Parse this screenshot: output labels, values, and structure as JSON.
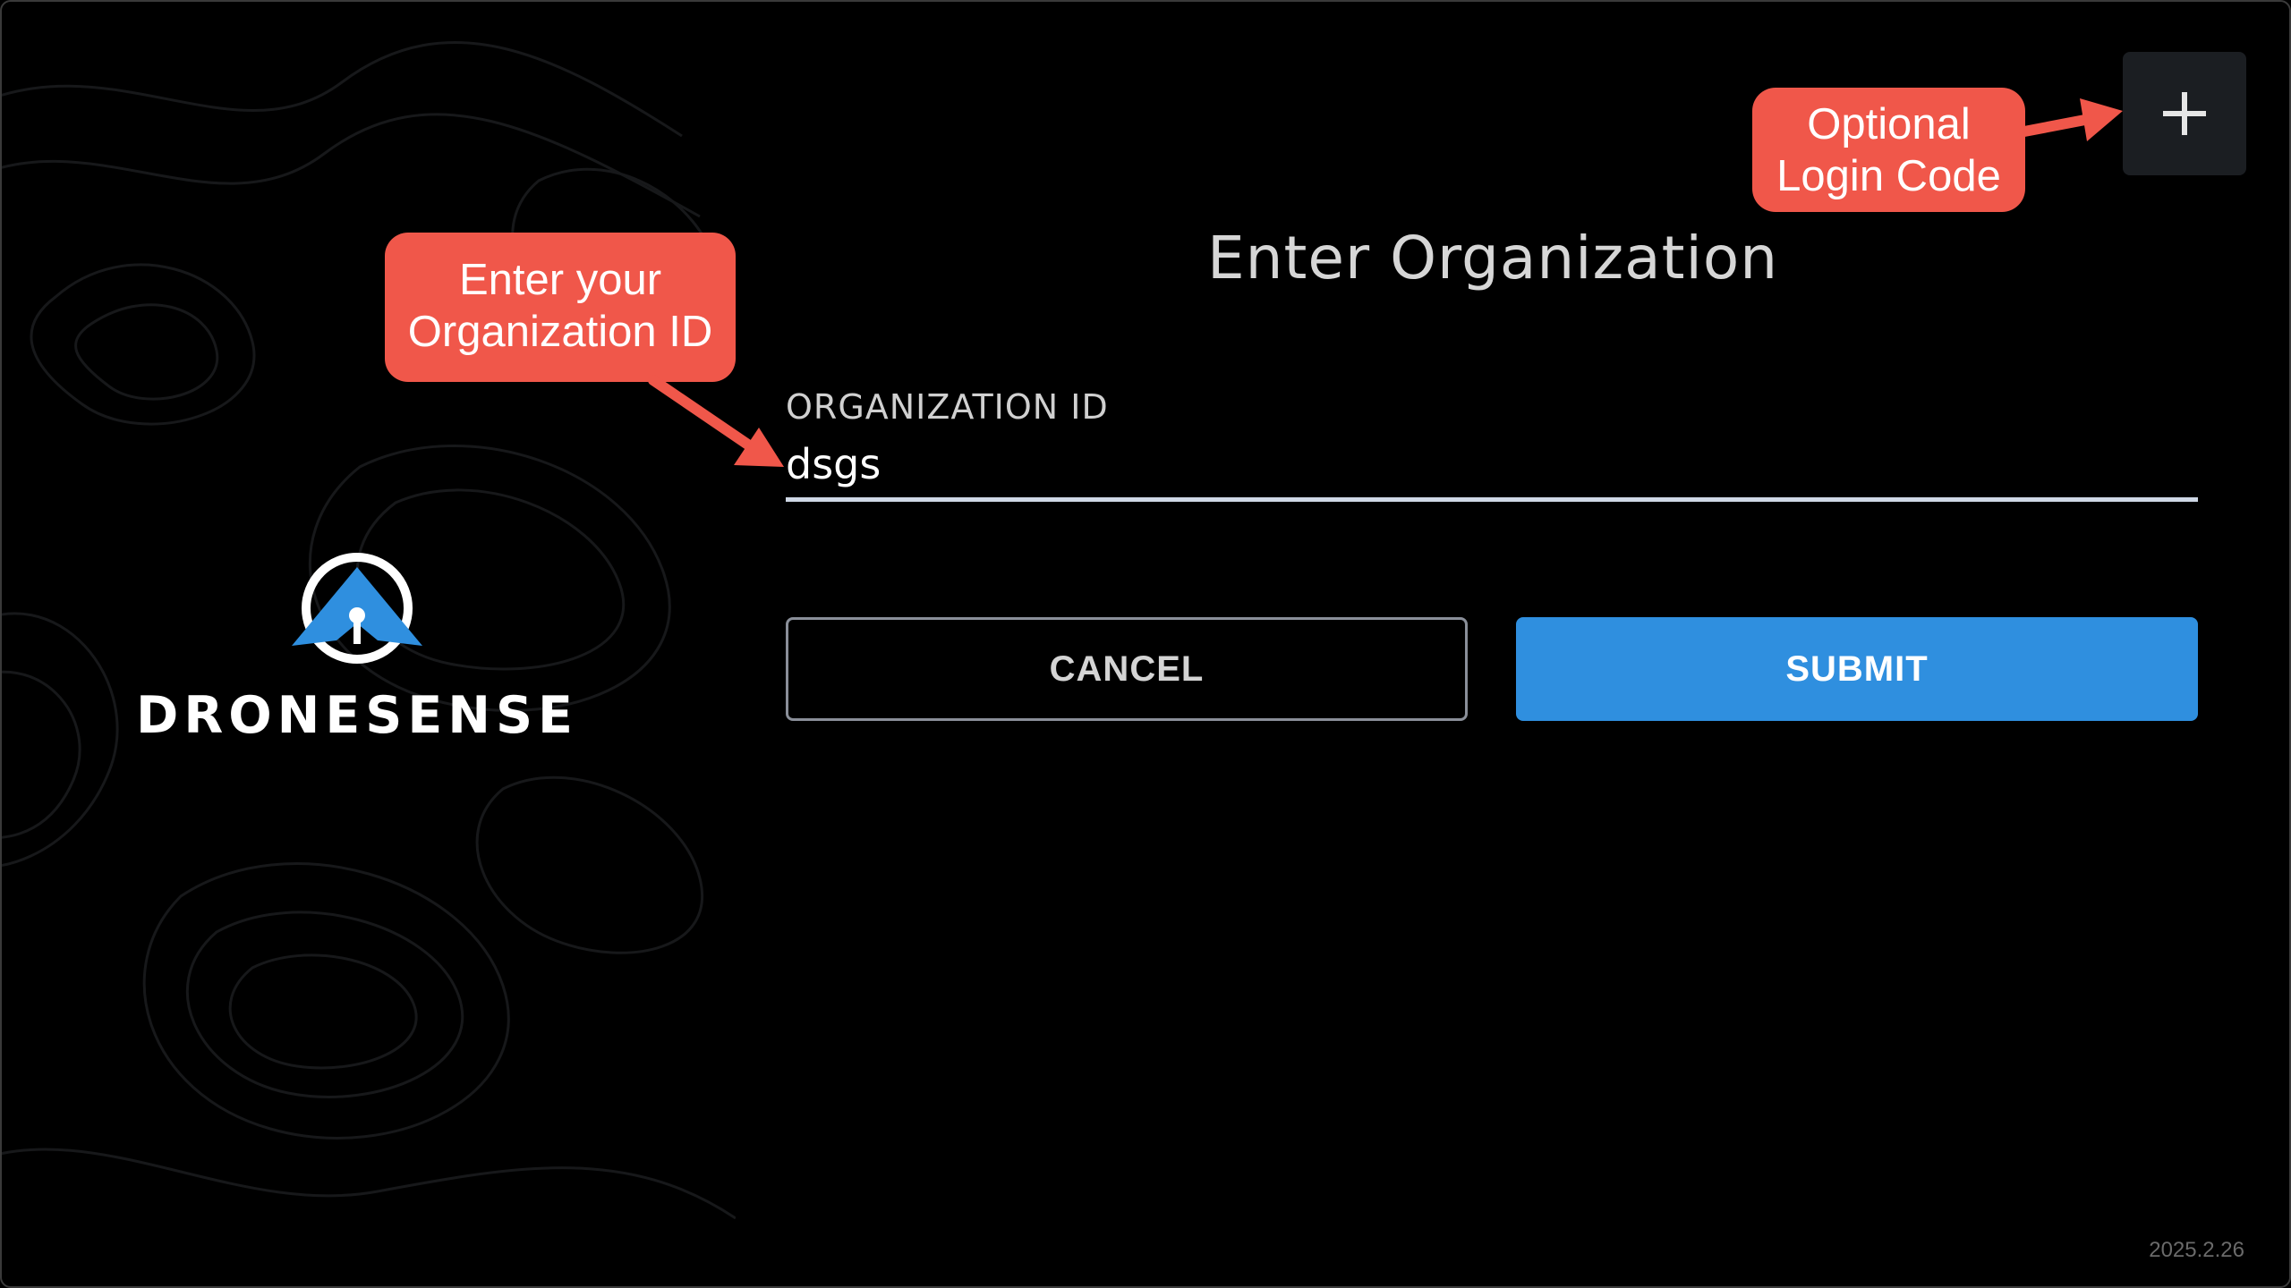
{
  "page_title": "Enter Organization",
  "form": {
    "field_label": "ORGANIZATION ID",
    "field_value": "dsgs",
    "cancel_label": "CANCEL",
    "submit_label": "SUBMIT"
  },
  "brand": {
    "wordmark": "DRONESENSE",
    "accent_color": "#2f8fdf"
  },
  "toolbar": {
    "add_icon": "plus-icon"
  },
  "version": "2025.2.26",
  "annotations": {
    "org_callout": [
      "Enter your",
      "Organization ID"
    ],
    "code_callout": [
      "Optional",
      "Login Code"
    ],
    "callout_color": "#f0574a"
  }
}
